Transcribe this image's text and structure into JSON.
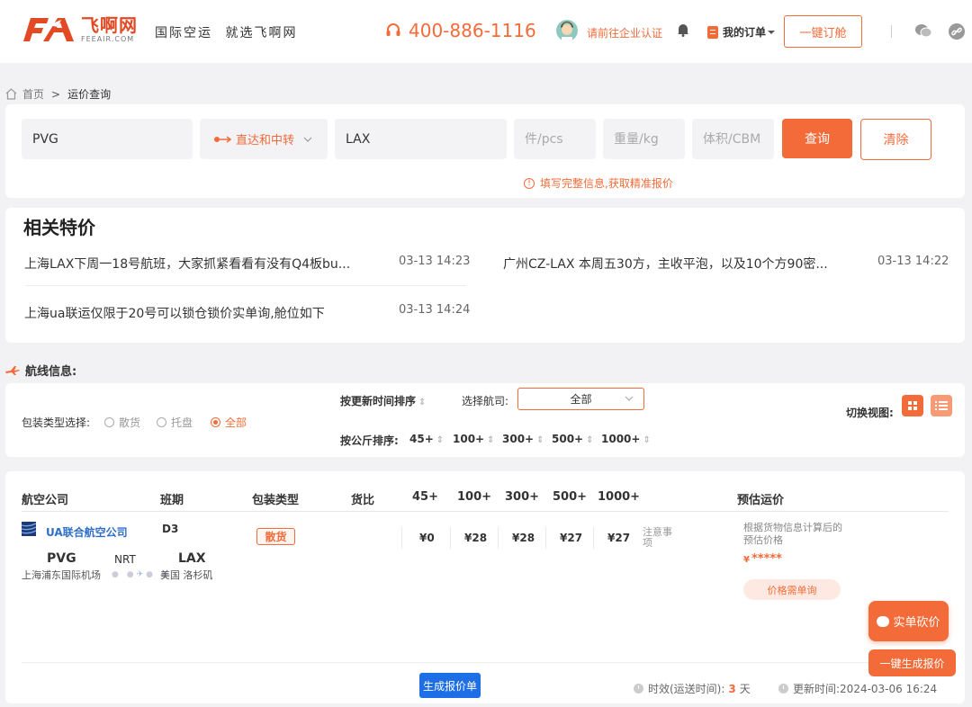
{
  "header": {
    "logo_cn": "飞啊网",
    "logo_en": "FEEAIR.COM",
    "slogan": "国际空运 就选飞啊网",
    "hotline": "400-886-1116",
    "cert_link": "请前往企业认证",
    "orders_label": "我的订单",
    "booking_button": "一键订舱"
  },
  "breadcrumb": {
    "home": "首页",
    "separator": ">",
    "current": "运价查询"
  },
  "search": {
    "origin": "PVG",
    "route_type": "直达和中转",
    "destination": "LAX",
    "pieces_placeholder": "件/pcs",
    "weight_placeholder": "重量/kg",
    "volume_placeholder": "体积/CBM",
    "query_button": "查询",
    "clear_button": "清除",
    "tip": "填写完整信息,获取精准报价"
  },
  "specials": {
    "title": "相关特价",
    "items": [
      {
        "text": "上海LAX下周一18号航班，大家抓紧看看有没有Q4板bu...",
        "time": "03-13 14:23"
      },
      {
        "text": "广州CZ-LAX 本周五30方，主收平泡，以及10个方90密...",
        "time": "03-13 14:22"
      },
      {
        "text": "上海ua联运仅限于20号可以锁仓锁价实单询,舱位如下",
        "time": "03-13 14:24"
      }
    ]
  },
  "route_info": {
    "title": "航线信息:"
  },
  "filters": {
    "pack_label": "包装类型选择:",
    "pack_options": [
      "散货",
      "托盘",
      "全部"
    ],
    "pack_selected": "全部",
    "sort_update": "按更新时间排序",
    "airline_label": "选择航司:",
    "airline_selected": "全部",
    "sort_weight": "按公斤排序:",
    "weight_breaks": [
      "45+",
      "100+",
      "300+",
      "500+",
      "1000+"
    ],
    "view_label": "切换视图:"
  },
  "table": {
    "headers": [
      "航空公司",
      "班期",
      "包装类型",
      "货比",
      "45+",
      "100+",
      "300+",
      "500+",
      "1000+",
      "预估运价"
    ],
    "row": {
      "airline": "UA联合航空公司",
      "schedule": "D3",
      "cargo_type": "散货",
      "prices": [
        "¥0",
        "¥28",
        "¥28",
        "¥27",
        "¥27"
      ],
      "note": "注意事项",
      "origin_code": "PVG",
      "origin_name": "上海浦东国际机场",
      "transit": "NRT",
      "dest_code": "LAX",
      "dest_name": "美国 洛杉矶",
      "estimate_desc": "根据货物信息计算后的预估价格",
      "estimate_price_symbol": "¥",
      "estimate_price": "*****",
      "price_on_request": "价格需单询"
    },
    "generate_button": "生成报价单",
    "transit_time_label": "时效(运送时间):",
    "transit_time_value": "3",
    "transit_time_unit": "天",
    "updated_label": "更新时间:",
    "updated_value": "2024-03-06 16:24"
  },
  "floating": {
    "bargain": "实单砍价",
    "quick_quote": "一键生成报价"
  },
  "colors": {
    "accent": "#f36b39",
    "link_blue": "#2f6fc7",
    "button_blue": "#1e6ee6"
  }
}
